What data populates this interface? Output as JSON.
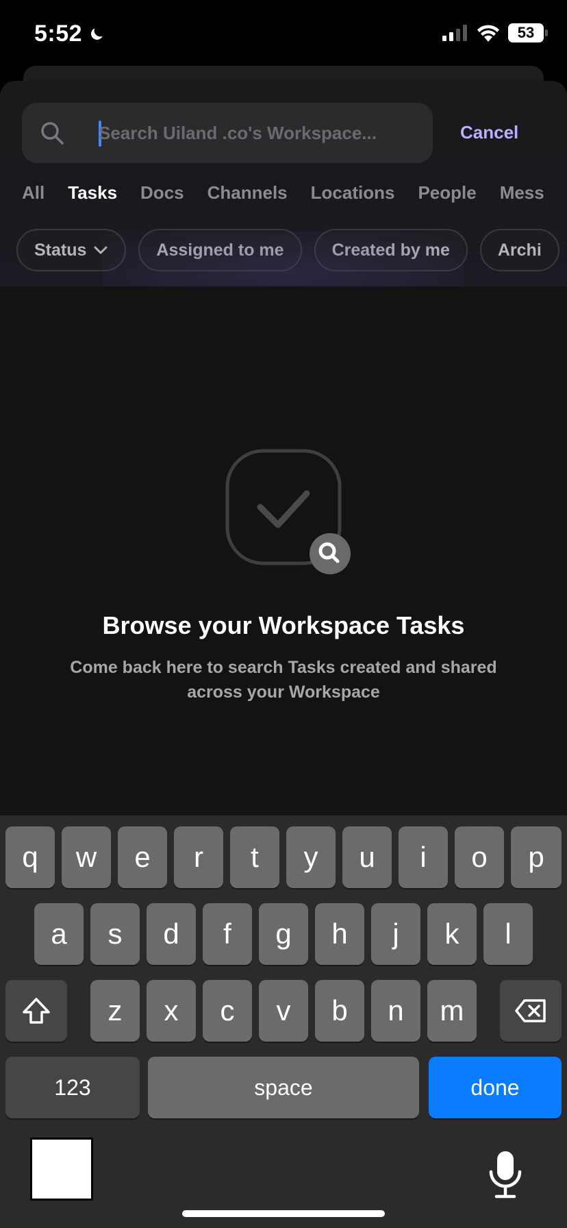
{
  "status_bar": {
    "time": "5:52",
    "battery": "53",
    "icons": [
      "moon-icon",
      "signal-icon",
      "wifi-icon",
      "battery-icon"
    ]
  },
  "search": {
    "placeholder": "Search Uiland .co's Workspace...",
    "value": "",
    "cancel_label": "Cancel"
  },
  "tabs": [
    {
      "label": "All",
      "active": false
    },
    {
      "label": "Tasks",
      "active": true
    },
    {
      "label": "Docs",
      "active": false
    },
    {
      "label": "Channels",
      "active": false
    },
    {
      "label": "Locations",
      "active": false
    },
    {
      "label": "People",
      "active": false
    },
    {
      "label": "Mess",
      "active": false
    }
  ],
  "chips": [
    {
      "label": "Status",
      "has_dropdown": true
    },
    {
      "label": "Assigned to me"
    },
    {
      "label": "Created by me"
    },
    {
      "label": "Archi"
    }
  ],
  "empty_state": {
    "title": "Browse your Workspace Tasks",
    "subtitle": "Come back here to search Tasks created and shared across your Workspace",
    "icon": "task-search-icon"
  },
  "keyboard": {
    "row1": [
      "q",
      "w",
      "e",
      "r",
      "t",
      "y",
      "u",
      "i",
      "o",
      "p"
    ],
    "row2": [
      "a",
      "s",
      "d",
      "f",
      "g",
      "h",
      "j",
      "k",
      "l"
    ],
    "row3": [
      "z",
      "x",
      "c",
      "v",
      "b",
      "n",
      "m"
    ],
    "numbers_label": "123",
    "space_label": "space",
    "done_label": "done"
  },
  "colors": {
    "accent": "#b6b0ff",
    "done_key": "#0a7cff",
    "caret": "#3f88ff"
  }
}
